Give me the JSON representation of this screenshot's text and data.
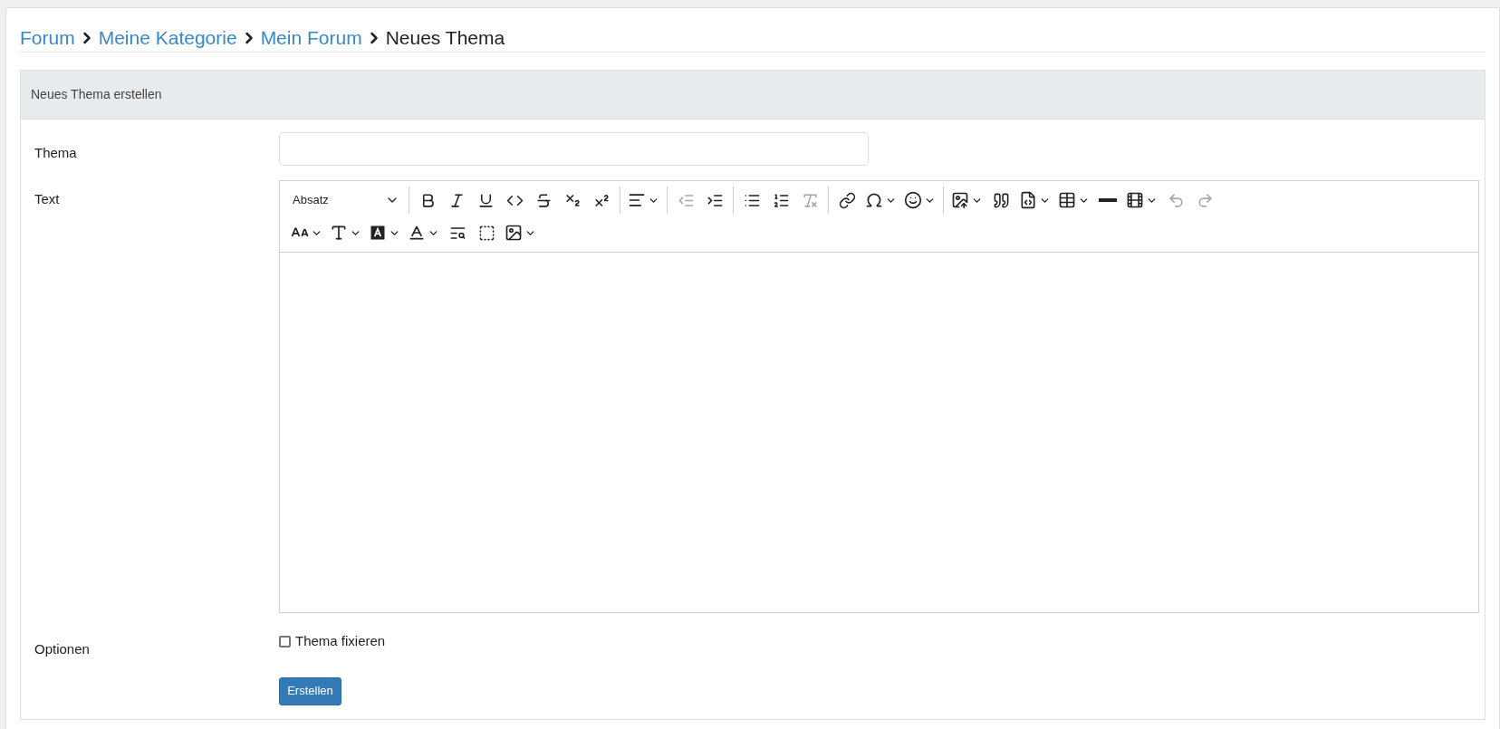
{
  "breadcrumb": [
    {
      "label": "Forum",
      "kind": "link"
    },
    {
      "label": "Meine Kategorie",
      "kind": "link"
    },
    {
      "label": "Mein Forum",
      "kind": "link"
    },
    {
      "label": "Neues Thema",
      "kind": "current"
    }
  ],
  "card": {
    "title": "Neues Thema erstellen"
  },
  "form": {
    "subject": {
      "label": "Thema"
    },
    "text": {
      "label": "Text",
      "format_select": "Absatz",
      "toolbar": [
        [
          {
            "kind": "select"
          },
          {
            "kind": "separator"
          },
          {
            "kind": "button",
            "disabled": false
          },
          {
            "kind": "button",
            "disabled": false
          },
          {
            "kind": "button",
            "disabled": false
          },
          {
            "kind": "button",
            "disabled": false
          },
          {
            "kind": "button",
            "disabled": false
          },
          {
            "kind": "button",
            "disabled": false
          },
          {
            "kind": "button",
            "disabled": false
          },
          {
            "kind": "separator"
          },
          {
            "kind": "split",
            "disabled": false
          },
          {
            "kind": "separator"
          },
          {
            "kind": "button",
            "disabled": true
          },
          {
            "kind": "button",
            "disabled": false
          },
          {
            "kind": "separator"
          },
          {
            "kind": "button",
            "disabled": false
          },
          {
            "kind": "button",
            "disabled": false
          },
          {
            "kind": "button",
            "disabled": true
          },
          {
            "kind": "separator"
          },
          {
            "kind": "button",
            "disabled": false
          },
          {
            "kind": "split",
            "disabled": false
          },
          {
            "kind": "split",
            "disabled": false
          },
          {
            "kind": "separator"
          },
          {
            "kind": "split",
            "disabled": false
          },
          {
            "kind": "button",
            "disabled": false
          },
          {
            "kind": "split",
            "disabled": false
          },
          {
            "kind": "split",
            "disabled": false
          },
          {
            "kind": "button",
            "disabled": false
          },
          {
            "kind": "split",
            "disabled": false
          },
          {
            "kind": "button",
            "disabled": true
          },
          {
            "kind": "button",
            "disabled": true
          }
        ],
        [
          {
            "kind": "split",
            "disabled": false
          },
          {
            "kind": "split",
            "disabled": false
          },
          {
            "kind": "split",
            "disabled": false
          },
          {
            "kind": "split",
            "disabled": false
          },
          {
            "kind": "button",
            "disabled": false
          },
          {
            "kind": "button",
            "disabled": false
          },
          {
            "kind": "split",
            "disabled": false
          }
        ]
      ]
    },
    "options": {
      "label": "Optionen",
      "items": [
        {
          "label": "Thema fixieren",
          "checked": false
        }
      ]
    },
    "submit": "Erstellen"
  }
}
